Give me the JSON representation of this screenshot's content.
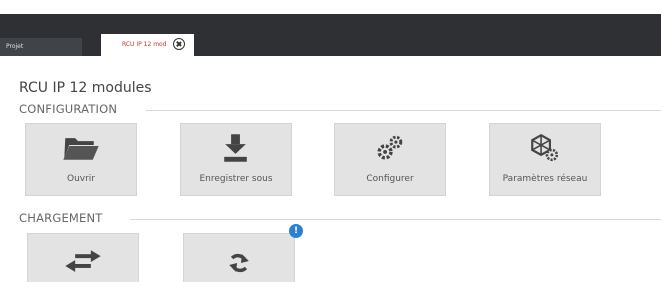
{
  "tabs": [
    {
      "label": "Projet"
    },
    {
      "label": "RCU IP 12 mod"
    }
  ],
  "page": {
    "title": "RCU IP 12 modules"
  },
  "sections": {
    "configuration": "CONFIGURATION",
    "chargement": "CHARGEMENT"
  },
  "configuration_tiles": [
    {
      "label": "Ouvrir",
      "icon": "folder-open-icon"
    },
    {
      "label": "Enregistrer sous",
      "icon": "download-icon"
    },
    {
      "label": "Configurer",
      "icon": "gears-icon"
    },
    {
      "label": "Paramètres réseau",
      "icon": "network-settings-icon"
    }
  ],
  "chargement_tiles": [
    {
      "label": "",
      "icon": "transfer-arrows-icon"
    },
    {
      "label": "",
      "icon": "refresh-icon",
      "badge": "!"
    }
  ],
  "colors": {
    "header_bg": "#2e3034",
    "active_tab_text": "#c0392b",
    "tile_bg": "#e3e3e3",
    "badge_bg": "#2e7fd0"
  }
}
